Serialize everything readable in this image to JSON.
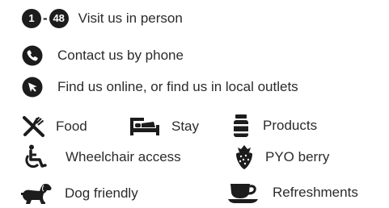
{
  "visit": {
    "range_start": "1",
    "range_separator": "-",
    "range_end": "48",
    "label": "Visit us in person"
  },
  "phone": {
    "label": "Contact us by phone"
  },
  "online": {
    "label": "Find us online, or find us in local outlets"
  },
  "categories": {
    "food": "Food",
    "stay": "Stay",
    "products": "Products",
    "wheelchair": "Wheelchair access",
    "pyo": "PYO berry",
    "dog": "Dog friendly",
    "refreshments": "Refreshments"
  },
  "icons": {
    "phone": "phone-icon",
    "cursor": "cursor-icon",
    "food": "cutlery-icon",
    "stay": "bed-icon",
    "products": "jar-icon",
    "wheelchair": "wheelchair-icon",
    "pyo": "strawberry-icon",
    "dog": "dog-icon",
    "refreshments": "teacup-icon"
  },
  "colors": {
    "icon": "#1c1c1c",
    "text": "#2b2b2b",
    "background": "#ffffff"
  }
}
